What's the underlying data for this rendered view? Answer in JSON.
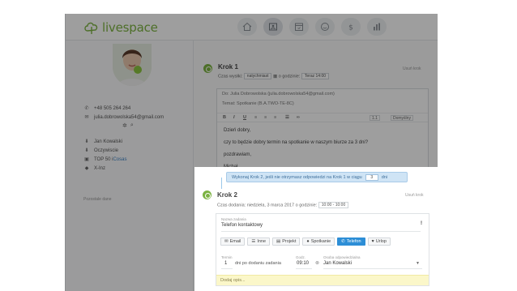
{
  "app": {
    "name": "livespace"
  },
  "nav": {
    "items": [
      {
        "icon": "home-icon"
      },
      {
        "icon": "contacts-icon"
      },
      {
        "icon": "calendar-icon"
      },
      {
        "icon": "face-icon"
      },
      {
        "icon": "money-icon"
      },
      {
        "icon": "chart-icon"
      }
    ]
  },
  "contact": {
    "phone": "+48 505 264 264",
    "email": "julia.dobrowolska54@gmail.com",
    "sub": [
      {
        "icon": "arrow-down-icon",
        "text": "Jan Kowalski"
      },
      {
        "icon": "arrow-down-icon",
        "text": "Oczywiscie"
      },
      {
        "icon": "building-icon",
        "text": "TOP 50 i ",
        "link": "Cosas"
      },
      {
        "icon": "tag-icon",
        "text": "X-Inz"
      }
    ],
    "more_label": "Pozostale dane"
  },
  "step1": {
    "title": "Krok 1",
    "delete": "Usuń krok",
    "meta_label": "Czas wysłki:",
    "meta_value": "natychmiast",
    "meta_time_label": "o godzinie:",
    "meta_time": "Teraz 14:00",
    "to_label": "Do:",
    "to_value": "Julia Dobrowolska (julia.dobrowolska54@gmail.com)",
    "subject_label": "Temat:",
    "subject_value": "Spotkanie (B.A.TWO-TE-8C)",
    "size_select": "1.1",
    "font_select": "Domyślny",
    "body": [
      "Dzień dobry,",
      "czy to będzie dobry termin na spotkanie w naszym biurze za 3 dni?",
      "pozdrawiam,",
      "Michał"
    ]
  },
  "tip": {
    "text_before": "Wykonaj Krok 2, jeśli nie otrzymasz odpowiedzi na Krok 1 w ciągu",
    "days": "3",
    "text_after": "dni"
  },
  "step2": {
    "title": "Krok 2",
    "delete": "Usuń krok",
    "meta_label": "Czas dodania:",
    "meta_value": "niedziela, 3 marca 2017 o godzinie:",
    "meta_time": "10:00 - 10:00",
    "name_label": "Nazwa zadania",
    "name_value": "Telefon kontaktowy",
    "buttons": [
      {
        "label": "Email",
        "icon": "mail-icon",
        "active": false
      },
      {
        "label": "Inne",
        "icon": "list-icon",
        "active": false
      },
      {
        "label": "Projekt",
        "icon": "folder-icon",
        "active": false
      },
      {
        "label": "Spotkanie",
        "icon": "users-icon",
        "active": false
      },
      {
        "label": "Telefon",
        "icon": "phone-icon",
        "active": true
      },
      {
        "label": "Urlop",
        "icon": "heart-icon",
        "active": false
      }
    ],
    "days_label": "Termin",
    "days_value": "1",
    "after_label": "dni po dodaniu zadania",
    "time_label": "Godz.",
    "time_value": "09:10",
    "owner_label": "Osoba odpowiedzialna",
    "owner_value": "Jan Kowalski",
    "note_placeholder": "Dodaj opis..."
  }
}
